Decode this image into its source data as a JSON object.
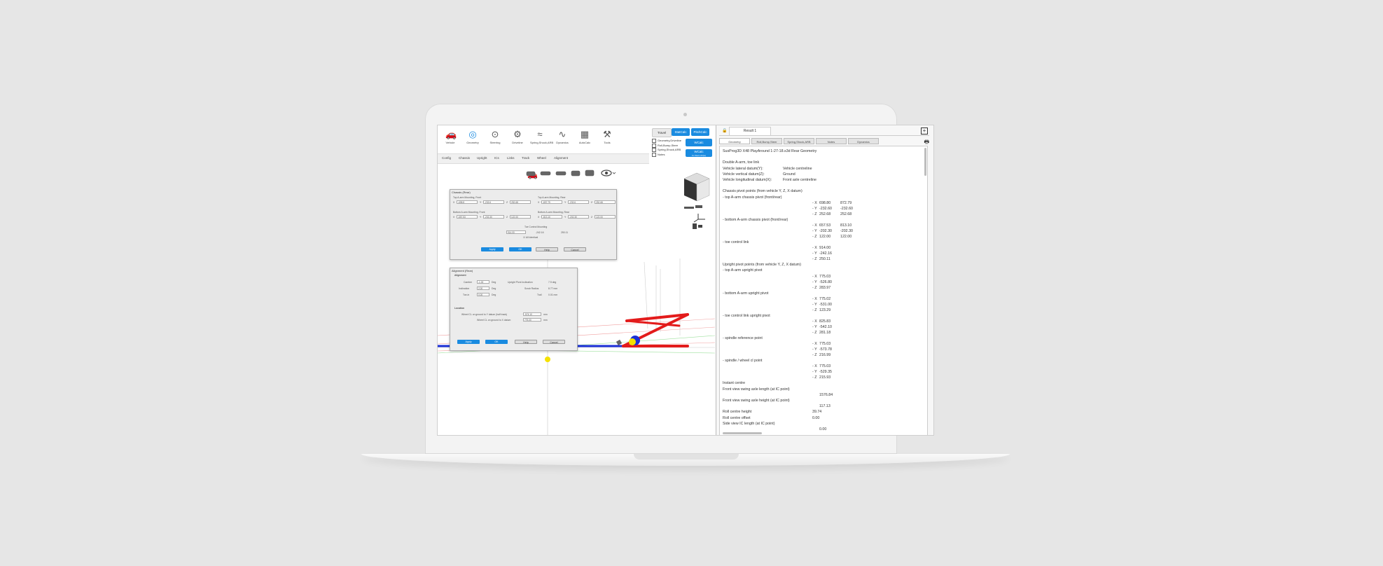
{
  "colors": {
    "accent": "#1a8be0",
    "red_arm": "#e31b1b",
    "blue_axle": "#1b2fd6",
    "yellow_point": "#f5e100"
  },
  "toolbar": [
    {
      "label": "Vehicle",
      "icon": "vehicle-icon"
    },
    {
      "label": "Geometry",
      "icon": "geometry-icon",
      "selected": true
    },
    {
      "label": "Steering",
      "icon": "steering-icon"
    },
    {
      "label": "Driveline",
      "icon": "driveline-icon"
    },
    {
      "label": "Spring,Shock,ARB",
      "icon": "spring-icon"
    },
    {
      "label": "Dynamics",
      "icon": "dynamics-icon"
    },
    {
      "label": "AutoCalc",
      "icon": "calculator-icon"
    },
    {
      "label": "Tools",
      "icon": "tools-icon"
    }
  ],
  "subnav": [
    "Config",
    "Chassis",
    "Upright",
    "ICs",
    "Links",
    "Track",
    "Wheel",
    "Alignment"
  ],
  "calc": {
    "travel": "Travel",
    "stat_calc": "StatCalc",
    "pitch_calc": "PitchCalc",
    "w_calc": "WCalc",
    "w_calc2": "WCalc",
    "w_calc2_sub": "Fo Stam Ah(w)",
    "checks": [
      "Geometry,Driveline",
      "Roll,Bump,Steer",
      "Spring,Shock,ARB",
      "Notes"
    ]
  },
  "chassis_dialog": {
    "title": "Chassis (Rear)",
    "top_front": "Top A-arm Mounting, Front",
    "top_rear": "Top A-arm Mounting, Rear",
    "bot_front": "Bottom A-arm Mounting, Front",
    "bot_rear": "Bottom A-arm Mounting, Rear",
    "toe_control": "Toe Control Mounting",
    "top_front_vals": [
      "-698.8",
      "-232.6",
      "252.68"
    ],
    "top_rear_vals": [
      "-897.79",
      "-232.6",
      "252.68"
    ],
    "bot_front_vals": [
      "-657.53",
      "-202.30",
      "122.00"
    ],
    "bot_rear_vals": [
      "-813.10",
      "-202.30",
      "122.00"
    ],
    "toe_vals": [
      "914.00",
      "-242.16",
      "250.11"
    ],
    "all_identical": "All Identical",
    "apply": "Apply",
    "ok": "OK",
    "help": "Help",
    "cancel": "Cancel"
  },
  "alignment_dialog": {
    "title": "Alignment (Rear)",
    "section_alignment": "Alignment",
    "camber_label": "Camber",
    "camber_val": "-1.00",
    "deg": "Deg",
    "inclination_label": "Inclination",
    "inclination_val": "2.00",
    "toein_label": "Toe-in",
    "toein_val": "0.00",
    "kpi_label": "Upright Pivot Inclination",
    "kpi_val": "7.9 deg",
    "scrub_label": "Scrub Radius",
    "scrub_val": "8.77 mm",
    "trail_label": "Trail",
    "trail_val": "0.01 mm",
    "section_location": "Location",
    "loc1_label": "Wheel CL on ground to Y datum (half track)",
    "loc1_val": "-574.10",
    "mm": "mm",
    "loc2_label": "Wheel CL on ground to X datum",
    "loc2_val": "775.00",
    "apply": "Apply",
    "ok": "OK",
    "help": "Help",
    "cancel": "Cancel"
  },
  "result": {
    "tab_title": "Result 1",
    "tabs": [
      "Geometry",
      "Roll,Bump,Steer",
      "Spring,Shock,ARB",
      "Notes",
      "Dynamics"
    ],
    "lines": [
      {
        "t": "SusProg3D X48 PlayAround 1-27-18.s3d Rear Geometry"
      },
      {
        "t": ""
      },
      {
        "t": "Double A-arm, toe link"
      },
      {
        "t": "Vehicle lateral datum(Y):",
        "v": "Vehicle centreline"
      },
      {
        "t": "Vehicle vertical datum(Z):",
        "v": "Ground"
      },
      {
        "t": "Vehicle longitudinal datum(X):",
        "v": "Front axle centreline"
      },
      {
        "t": ""
      },
      {
        "t": "Chassis pivot points (from vehicle Y, Z, X datum)"
      },
      {
        "t": "- top A-arm chassis pivot (front/rear)"
      },
      {
        "t": "",
        "c": "- X",
        "v": "698.80",
        "v2": "872.79"
      },
      {
        "t": "",
        "c": "- Y",
        "v": "-232.60",
        "v2": "-232.60"
      },
      {
        "t": "",
        "c": "- Z",
        "v": "252.68",
        "v2": "252.68"
      },
      {
        "t": "- bottom A-arm chassis pivot (front/rear)"
      },
      {
        "t": "",
        "c": "- X",
        "v": "657.53",
        "v2": "813.10"
      },
      {
        "t": "",
        "c": "- Y",
        "v": "-202.30",
        "v2": "-202.30"
      },
      {
        "t": "",
        "c": "- Z",
        "v": "122.00",
        "v2": "122.00"
      },
      {
        "t": "- toe control link"
      },
      {
        "t": "",
        "c": "- X",
        "v": "914.00"
      },
      {
        "t": "",
        "c": "- Y",
        "v": "-242.16"
      },
      {
        "t": "",
        "c": "- Z",
        "v": "250.11"
      },
      {
        "t": "Upright pivot points (from vehicle Y, Z, X datum)"
      },
      {
        "t": "- top A-arm upright pivot"
      },
      {
        "t": "",
        "c": "- X",
        "v": "775.03"
      },
      {
        "t": "",
        "c": "- Y",
        "v": "-526.80"
      },
      {
        "t": "",
        "c": "- Z",
        "v": "283.97"
      },
      {
        "t": "- bottom A-arm upright pivot"
      },
      {
        "t": "",
        "c": "- X",
        "v": "775.02"
      },
      {
        "t": "",
        "c": "- Y",
        "v": "-531.00"
      },
      {
        "t": "",
        "c": "- Z",
        "v": "123.29"
      },
      {
        "t": "- toe control link upright pivot"
      },
      {
        "t": "",
        "c": "- X",
        "v": "825.83"
      },
      {
        "t": "",
        "c": "- Y",
        "v": "-542.10"
      },
      {
        "t": "",
        "c": "- Z",
        "v": "281.18"
      },
      {
        "t": "- spindle reference point"
      },
      {
        "t": "",
        "c": "- X",
        "v": "775.03"
      },
      {
        "t": "",
        "c": "- Y",
        "v": "-573.78"
      },
      {
        "t": "",
        "c": "- Z",
        "v": "216.99"
      },
      {
        "t": "- spindle / wheel cl point"
      },
      {
        "t": "",
        "c": "- X",
        "v": "775.03"
      },
      {
        "t": "",
        "c": "- Y",
        "v": "-529.35"
      },
      {
        "t": "",
        "c": "- Z",
        "v": "215.93"
      },
      {
        "t": "Instant centre"
      },
      {
        "t": "Front view swing axle length (at IC point)"
      },
      {
        "t": "",
        "c": "",
        "v": "1576.84"
      },
      {
        "t": "Front view swing axle height (at IC point)"
      },
      {
        "t": "",
        "c": "",
        "v": "117.13"
      },
      {
        "t": "Roll centre height",
        "c": "",
        "v": "39.74"
      },
      {
        "t": "Roll centre offset",
        "c": "",
        "v": "0.00"
      },
      {
        "t": "Side view IC length (at IC point)"
      },
      {
        "t": "",
        "c": "",
        "v": "0.00"
      }
    ]
  }
}
